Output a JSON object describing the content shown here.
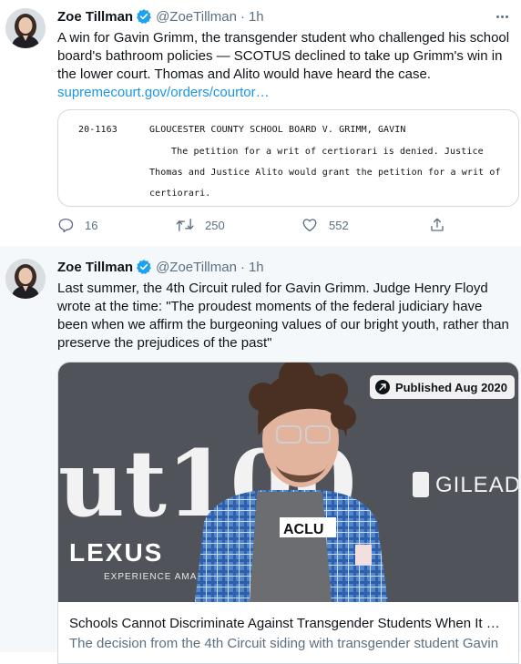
{
  "colors": {
    "link": "#1b95e0",
    "verified": "#1da1f2",
    "secondary_text": "#5b7083",
    "thread_background": "#f5f8fa"
  },
  "tweet1": {
    "author_name": "Zoe Tillman",
    "author_handle": "@ZoeTillman",
    "separator": "·",
    "time": "1h",
    "text": "A win for Gavin Grimm, the transgender student who challenged his school board's bathroom policies — SCOTUS declined to take up Grimm's win in the lower court. Thomas and Alito would have heard the case.",
    "link_text": "supremecourt.gov/orders/courtor…",
    "document": {
      "docket": "20-1163",
      "caption": "GLOUCESTER COUNTY SCHOOL BOARD V. GRIMM, GAVIN",
      "line1": "The petition for a writ of certiorari is denied.  Justice",
      "line2": "Thomas and Justice Alito would grant the petition for a writ of",
      "line3": "certiorari."
    },
    "replies": "16",
    "retweets": "250",
    "likes": "552",
    "icons": [
      "reply-icon",
      "retweet-icon",
      "like-icon",
      "share-icon",
      "more-icon",
      "verified-icon"
    ]
  },
  "tweet2": {
    "author_name": "Zoe Tillman",
    "author_handle": "@ZoeTillman",
    "separator": "·",
    "time": "1h",
    "text": "Last summer, the 4th Circuit ruled for Gavin Grimm. Judge Henry Floyd wrote at the time: \"The proudest moments of the federal judiciary have been when we affirm the burgeoning values of our bright youth, rather than preserve the prejudices of the past\"",
    "card": {
      "badge": "Published Aug 2020",
      "image_text_backdrop": "ut100",
      "image_text_sponsor1": "LEXUS",
      "image_text_sponsor1_sub": "EXPERIENCE AMAZ",
      "image_text_sponsor2": "GILEAD",
      "image_text_shirt": "ACLU",
      "title": "Schools Cannot Discriminate Against Transgender Students When It Co…",
      "description": "The decision from the 4th Circuit siding with transgender student Gavin"
    }
  }
}
